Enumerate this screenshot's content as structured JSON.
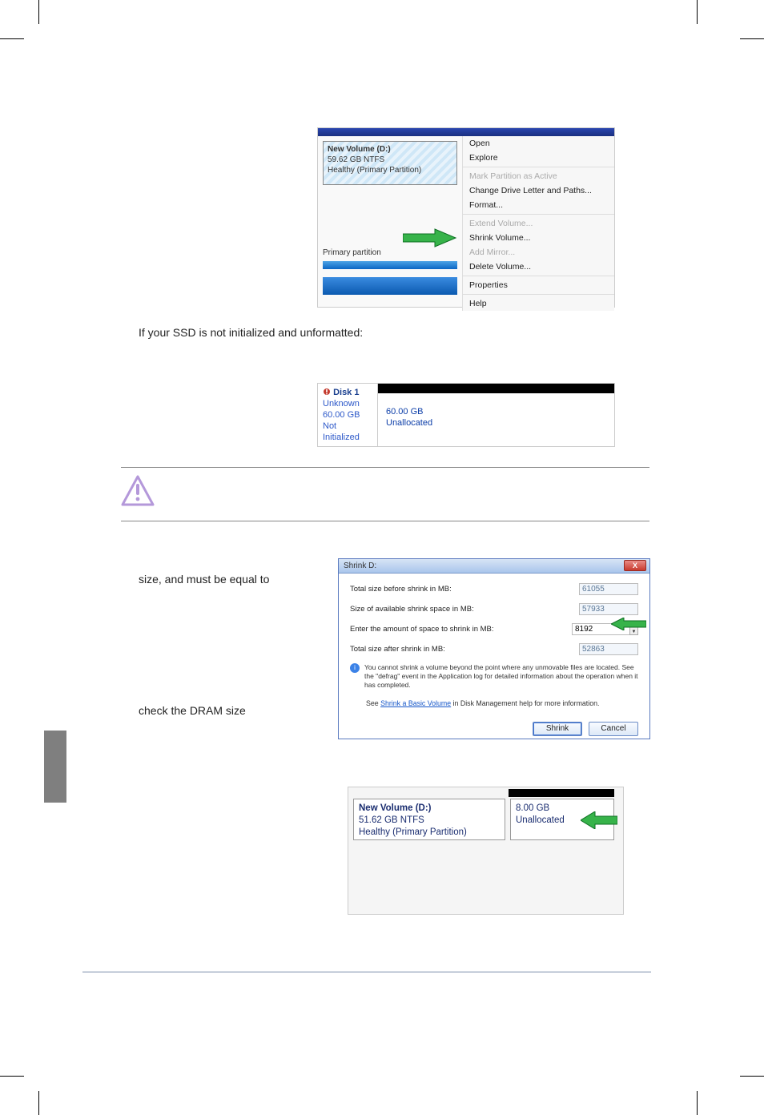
{
  "document": {
    "body_text_1": "If your SSD is not initialized and unformatted:",
    "caption_1a": "size, and must be equal to",
    "caption_1b": "check the DRAM size"
  },
  "context_menu": {
    "volume": {
      "name": "New Volume  (D:)",
      "size_fs": "59.62 GB NTFS",
      "status": "Healthy (Primary Partition)"
    },
    "primary_label": "Primary partition",
    "items": [
      {
        "label": "Open",
        "enabled": true
      },
      {
        "label": "Explore",
        "enabled": true
      },
      {
        "label": "Mark Partition as Active",
        "enabled": false
      },
      {
        "label": "Change Drive Letter and Paths...",
        "enabled": true
      },
      {
        "label": "Format...",
        "enabled": true
      },
      {
        "label": "Extend Volume...",
        "enabled": false
      },
      {
        "label": "Shrink Volume...",
        "enabled": true
      },
      {
        "label": "Add Mirror...",
        "enabled": false
      },
      {
        "label": "Delete Volume...",
        "enabled": true
      },
      {
        "label": "Properties",
        "enabled": true
      },
      {
        "label": "Help",
        "enabled": true
      }
    ]
  },
  "disk_row": {
    "disk_name": "Disk 1",
    "unknown": "Unknown",
    "size": "60.00 GB",
    "status": "Not Initialized",
    "right_size": "60.00 GB",
    "right_status": "Unallocated"
  },
  "shrink_dialog": {
    "title": "Shrink D:",
    "close": "X",
    "row1_label": "Total size before shrink in MB:",
    "row1_value": "61055",
    "row2_label": "Size of available shrink space in MB:",
    "row2_value": "57933",
    "row3_label": "Enter the amount of space to shrink in MB:",
    "row3_value": "8192",
    "row4_label": "Total size after shrink in MB:",
    "row4_value": "52863",
    "info_text": "You cannot shrink a volume beyond the point where any unmovable files are located. See the \"defrag\" event in the Application log for detailed information about the operation when it has completed.",
    "help_pre": "See ",
    "help_link": "Shrink a Basic Volume",
    "help_post": " in Disk Management help for more information.",
    "btn_shrink": "Shrink",
    "btn_cancel": "Cancel"
  },
  "partition_row": {
    "volA": {
      "name": "New Volume  (D:)",
      "size_fs": "51.62 GB NTFS",
      "status": "Healthy (Primary Partition)"
    },
    "volB": {
      "size": "8.00 GB",
      "status": "Unallocated"
    }
  }
}
